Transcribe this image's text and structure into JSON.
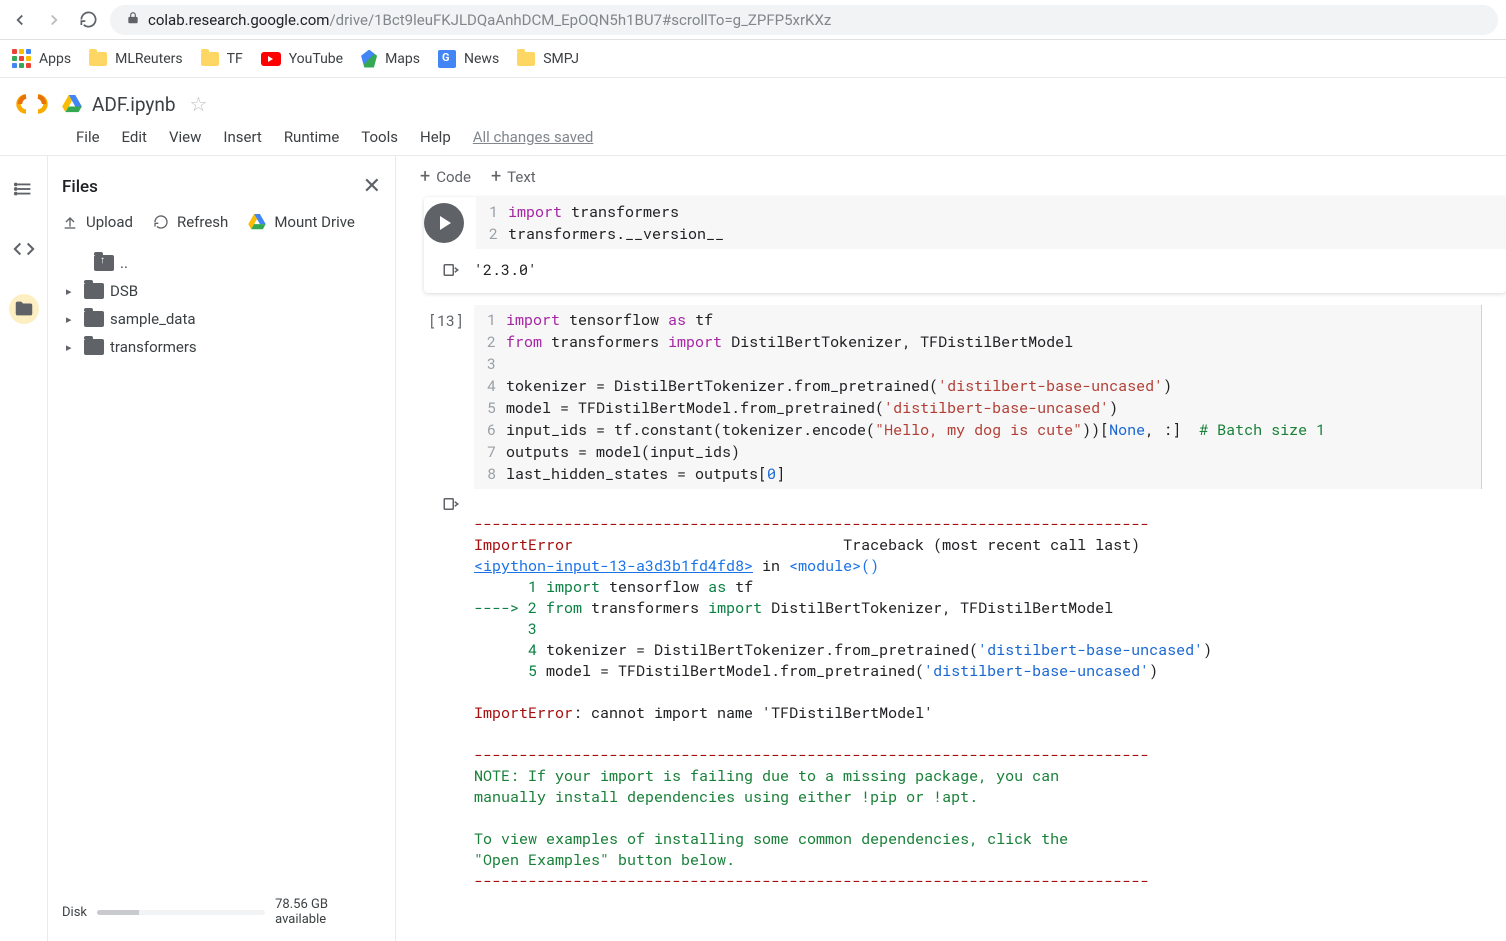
{
  "browser": {
    "url_domain": "colab.research.google.com",
    "url_path": "/drive/1Bct9leuFKJLDQaAnhDCM_EpOQN5h1BU7#scrollTo=g_ZPFP5xrKXz"
  },
  "bookmarks": {
    "apps": "Apps",
    "mlreuters": "MLReuters",
    "tf": "TF",
    "youtube": "YouTube",
    "maps": "Maps",
    "news": "News",
    "smpj": "SMPJ"
  },
  "colab": {
    "title": "ADF.ipynb",
    "menus": {
      "file": "File",
      "edit": "Edit",
      "view": "View",
      "insert": "Insert",
      "runtime": "Runtime",
      "tools": "Tools",
      "help": "Help"
    },
    "save_status": "All changes saved"
  },
  "files_panel": {
    "title": "Files",
    "upload": "Upload",
    "refresh": "Refresh",
    "mount": "Mount Drive",
    "tree": {
      "up": "..",
      "dsb": "DSB",
      "sample": "sample_data",
      "transformers": "transformers"
    },
    "disk_label": "Disk",
    "disk_available": "78.56 GB available"
  },
  "toolbar": {
    "code": "Code",
    "text": "Text"
  },
  "cell1": {
    "ln1": "1",
    "code1_kw": "import",
    "code1_rest": " transformers",
    "ln2": "2",
    "code2": "transformers.__version__",
    "out": "'2.3.0'"
  },
  "cell13": {
    "exec": "[13]",
    "lines": {
      "n1": "1",
      "n2": "2",
      "n3": "3",
      "n4": "4",
      "n5": "5",
      "n6": "6",
      "n7": "7",
      "n8": "8"
    },
    "l1_kw": "import",
    "l1_mid": " tensorflow ",
    "l1_as": "as",
    "l1_end": " tf",
    "l2_from": "from",
    "l2_mid": " transformers ",
    "l2_imp": "import",
    "l2_end": " DistilBertTokenizer, TFDistilBertModel",
    "l4_a": "tokenizer = DistilBertTokenizer.from_pretrained(",
    "l4_s": "'distilbert-base-uncased'",
    "l4_b": ")",
    "l5_a": "model = TFDistilBertModel.from_pretrained(",
    "l5_s": "'distilbert-base-uncased'",
    "l5_b": ")",
    "l6_a": "input_ids = tf.constant(tokenizer.encode(",
    "l6_s": "\"Hello, my dog is cute\"",
    "l6_b": "))[",
    "l6_none": "None",
    "l6_c": ", :]  ",
    "l6_cmt": "# Batch size 1",
    "l7": "outputs = model(input_ids)",
    "l8_a": "last_hidden_states = outputs[",
    "l8_n": "0",
    "l8_b": "]"
  },
  "traceback": {
    "dash_top": "---------------------------------------------------------------------------",
    "err_name": "ImportError",
    "trace_hdr": "                              Traceback (most recent call last)",
    "ipy_link": "<ipython-input-13-a3d3b1fd4fd8>",
    "in": " in ",
    "module": "<module>",
    "parens": "()",
    "l1": "      1 ",
    "l1_kw": "import",
    "l1_rest": " tensorflow ",
    "l1_as": "as",
    "l1_tf": " tf",
    "arrow": "----> 2 ",
    "l2_from": "from",
    "l2_mid": " transformers ",
    "l2_imp": "import",
    "l2_rest": " DistilBertTokenizer, TFDistilBertModel",
    "l3": "      3 ",
    "l4": "      4 ",
    "l4_body": "tokenizer = DistilBertTokenizer.from_pretrained(",
    "l4_s": "'distilbert-base-uncased'",
    "l4_e": ")",
    "l5": "      5 ",
    "l5_body": "model = TFDistilBertModel.from_pretrained(",
    "l5_s": "'distilbert-base-uncased'",
    "l5_e": ")",
    "err2": "ImportError",
    "err2_msg": ": cannot import name 'TFDistilBertModel'",
    "dash_mid": "---------------------------------------------------------------------------",
    "note1": "NOTE: If your import is failing due to a missing package, you can",
    "note2": "manually install dependencies using either !pip or !apt.",
    "note3": "To view examples of installing some common dependencies, click the",
    "note4": "\"Open Examples\" button below.",
    "dash_bot": "---------------------------------------------------------------------------"
  }
}
